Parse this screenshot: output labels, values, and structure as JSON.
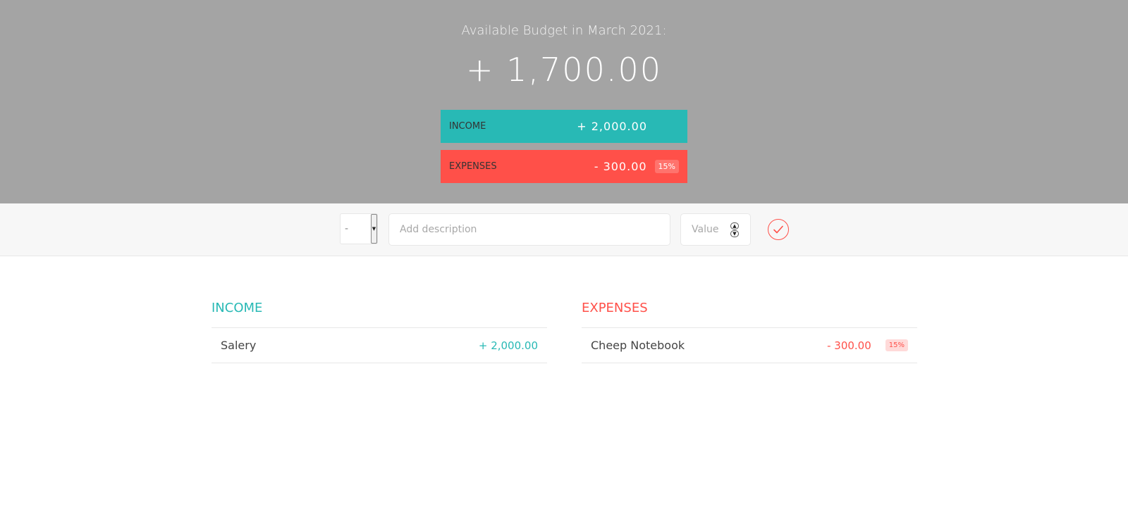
{
  "header": {
    "title": "Available Budget in March 2021:",
    "budget": "+ 1,700.00"
  },
  "summary": {
    "income": {
      "label": "Income",
      "value": "+ 2,000.00"
    },
    "expenses": {
      "label": "Expenses",
      "value": "- 300.00",
      "percentage": "15%"
    }
  },
  "add_bar": {
    "type_selected": "-",
    "description_placeholder": "Add description",
    "value_placeholder": "Value"
  },
  "lists": {
    "income": {
      "title": "Income",
      "items": [
        {
          "description": "Salery",
          "value": "+ 2,000.00"
        }
      ]
    },
    "expenses": {
      "title": "Expenses",
      "items": [
        {
          "description": "Cheep Notebook",
          "value": "- 300.00",
          "percentage": "15%"
        }
      ]
    }
  },
  "colors": {
    "income": "#28b9b5",
    "expenses": "#ff5049",
    "top_background": "#a4a4a4"
  },
  "icons": {
    "submit": "checkmark-circle-icon",
    "select_arrow": "caret-down-icon"
  }
}
